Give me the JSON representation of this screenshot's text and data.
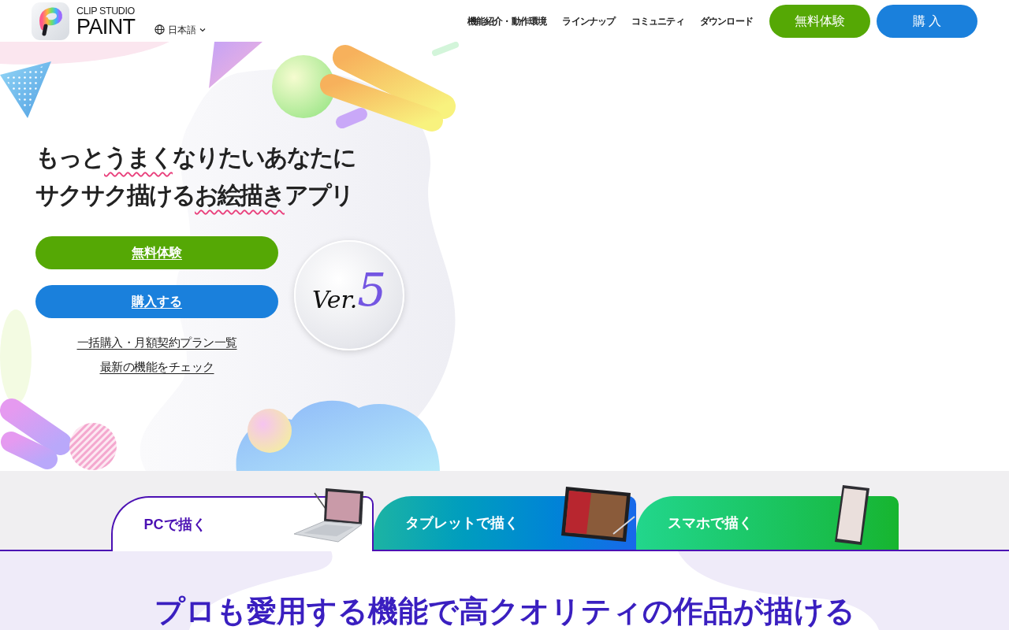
{
  "header": {
    "logo": {
      "subtitle": "CLIP STUDIO",
      "title": "PAINT"
    },
    "language": {
      "label": "日本語"
    },
    "nav": [
      "機能紹介・動作環境",
      "ラインナップ",
      "コミュニティ",
      "ダウンロード"
    ],
    "buttons": [
      {
        "label": "無料体験",
        "kind": "trial"
      },
      {
        "label": "購 入",
        "kind": "buy"
      }
    ]
  },
  "hero": {
    "headline": [
      [
        {
          "text": "もっと",
          "wavy": false
        },
        {
          "text": "うまく",
          "wavy": true
        },
        {
          "text": "なりたいあなたに",
          "wavy": false
        }
      ],
      [
        {
          "text": "サクサク描ける",
          "wavy": false
        },
        {
          "text": "お絵描き",
          "wavy": true
        },
        {
          "text": "アプリ",
          "wavy": false
        }
      ]
    ],
    "buttons": [
      {
        "label": "無料体験",
        "kind": "trial"
      },
      {
        "label": "購入する",
        "kind": "buy"
      }
    ],
    "links": [
      "一括購入・月額契約プラン一覧",
      "最新の機能をチェック"
    ],
    "badge": {
      "prefix": "Ver.",
      "number": "5"
    }
  },
  "device_tabs": [
    {
      "label": "PCで描く",
      "kind": "laptop",
      "selected": true
    },
    {
      "label": "タブレットで描く",
      "kind": "tablet",
      "selected": false
    },
    {
      "label": "スマホで描く",
      "kind": "phone",
      "selected": false
    }
  ],
  "features": {
    "heading": "プロも愛用する機能で高クオリティの作品が描ける"
  }
}
